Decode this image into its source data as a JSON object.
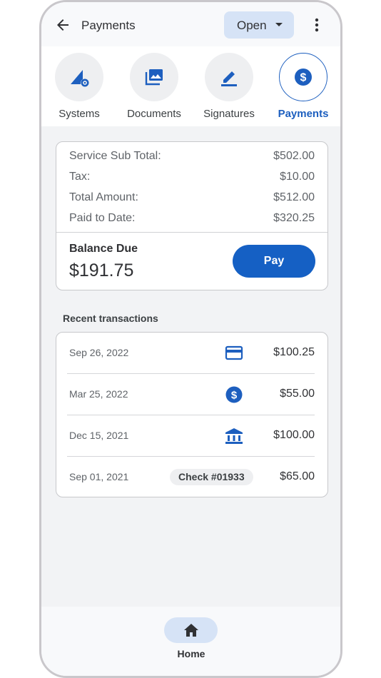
{
  "header": {
    "title": "Payments",
    "status": "Open"
  },
  "tabs": [
    {
      "label": "Systems",
      "icon": "systems-icon"
    },
    {
      "label": "Documents",
      "icon": "documents-icon"
    },
    {
      "label": "Signatures",
      "icon": "signature-icon"
    },
    {
      "label": "Payments",
      "icon": "dollar-circle-icon",
      "active": true
    }
  ],
  "summary": {
    "rows": [
      {
        "label": "Service Sub Total:",
        "value": "$502.00"
      },
      {
        "label": "Tax:",
        "value": "$10.00"
      },
      {
        "label": "Total Amount:",
        "value": "$512.00"
      },
      {
        "label": "Paid to Date:",
        "value": "$320.25"
      }
    ],
    "balance_label": "Balance Due",
    "balance_amount": "$191.75",
    "pay_label": "Pay"
  },
  "transactions": {
    "title": "Recent transactions",
    "items": [
      {
        "date": "Sep 26, 2022",
        "method": "credit-card-icon",
        "amount": "$100.25"
      },
      {
        "date": "Mar 25, 2022",
        "method": "dollar-circle-icon",
        "amount": "$55.00"
      },
      {
        "date": "Dec 15, 2021",
        "method": "bank-icon",
        "amount": "$100.00"
      },
      {
        "date": "Sep 01, 2021",
        "method_label": "Check #01933",
        "amount": "$65.00"
      }
    ]
  },
  "bottom_nav": {
    "home_label": "Home"
  },
  "colors": {
    "accent": "#1560c4",
    "accent_light": "#d6e3f6",
    "background": "#f2f3f5"
  }
}
